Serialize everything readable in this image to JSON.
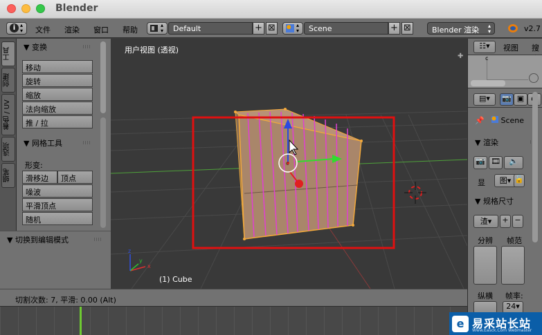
{
  "window": {
    "title": "Blender"
  },
  "menubar": {
    "items": [
      "文件",
      "渲染",
      "窗口",
      "帮助"
    ],
    "screen_layout": "Default",
    "scene": "Scene",
    "render_engine": "Blender 渲染",
    "version": "v2.7"
  },
  "vertical_tabs": [
    "工具",
    "创建",
    "着色 / UV",
    "选项",
    "蜡笔"
  ],
  "tool_shelf": {
    "transform_header": "变换",
    "transform_buttons": [
      "移动",
      "旋转",
      "缩放",
      "法向缩放",
      "推 / 拉"
    ],
    "mesh_tools_header": "网格工具",
    "deform_label": "形变:",
    "slide_edge": "滑移边",
    "vertex": "顶点",
    "deform_buttons": [
      "噪波",
      "平滑顶点",
      "随机"
    ],
    "toggle_edit_header": "切换到编辑模式"
  },
  "viewport": {
    "view_label": "用户视图 (透视)",
    "object_label": "(1) Cube",
    "axis_labels": {
      "x": "x",
      "y": "y",
      "z": "z"
    },
    "pivot_label": "c"
  },
  "properties": {
    "outliner_view": "视图",
    "outliner_search": "搜索",
    "scene_name": "Scene",
    "render_header": "渲染",
    "display_label": "显",
    "display_value": "图",
    "dimensions_header": "规格尺寸",
    "preset_label": "渣",
    "resolution_label": "分辨",
    "frame_range_label": "帧范",
    "aspect_label": "纵横",
    "frame_rate_label": "帧率:",
    "frame_rate_value": "24"
  },
  "status": {
    "text": "切割次数: 7, 平滑: 0.00 (Alt)"
  },
  "watermark": {
    "text": "易采站长站",
    "sub": "Www.Easck.Com Webmaster"
  }
}
